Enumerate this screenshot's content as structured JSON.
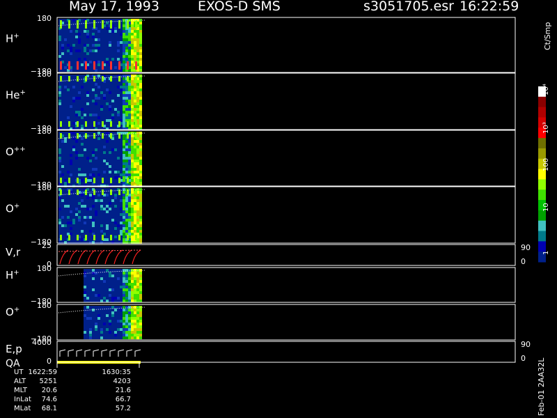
{
  "header": {
    "date": "May 17, 1993",
    "instrument": "EXOS-D SMS",
    "file": "s3051705.esr",
    "time": "16:22:59"
  },
  "panels": [
    {
      "label_base": "H",
      "label_sup": "+",
      "ytop": "180",
      "ybot": "−180"
    },
    {
      "label_base": "He",
      "label_sup": "+",
      "ytop": "180",
      "ybot": "−180"
    },
    {
      "label_base": "O",
      "label_sup": "++",
      "ytop": "180",
      "ybot": "−180"
    },
    {
      "label_base": "O",
      "label_sup": "+",
      "ytop": "180",
      "ybot": "−180"
    },
    {
      "label_base": "V,r",
      "label_sup": "",
      "ytop": "25",
      "ybot": "0",
      "rtop": "90",
      "rbot": "0"
    },
    {
      "label_base": "H",
      "label_sup": "+",
      "ytop": "180",
      "ybot": "−180"
    },
    {
      "label_base": "O",
      "label_sup": "+",
      "ytop": "180",
      "ybot": "−180"
    },
    {
      "label_base": "E,p",
      "label_sup": "",
      "label2": "QA",
      "ytop": "4000",
      "ybot": "0",
      "rtop": "90",
      "rbot": "0"
    }
  ],
  "colorbar": {
    "label": "Ct/Smp",
    "ticks": [
      "10⁴",
      "10³",
      "100",
      "10",
      "1"
    ],
    "colors": [
      "#ffffff",
      "#8b0000",
      "#b00000",
      "#d40000",
      "#ff0000",
      "#707000",
      "#9a9a00",
      "#c8c800",
      "#ffff00",
      "#90ff00",
      "#40e000",
      "#00c000",
      "#00a000",
      "#40c0c0",
      "#007a8a",
      "#0000b0",
      "#00208a"
    ]
  },
  "time_table": {
    "rows": [
      {
        "label": "UT",
        "v1": "1622:59",
        "v2": "1630:35"
      },
      {
        "label": "ALT",
        "v1": "5251",
        "v2": "4203"
      },
      {
        "label": "MLT",
        "v1": "20.6",
        "v2": "21.6"
      },
      {
        "label": "InLat",
        "v1": "74.6",
        "v2": "66.7"
      },
      {
        "label": "MLat",
        "v1": "68.1",
        "v2": "57.2"
      }
    ]
  },
  "footer_id": "Feb-01 2AA32L",
  "chart_data": {
    "type": "heatmap",
    "title": "May 17, 1993   EXOS-D SMS",
    "xlabel": "UT",
    "x_ticks": [
      "1622:59",
      "1630:35"
    ],
    "ylim_angle": [
      -180,
      180
    ],
    "colorscale_label": "Ct/Smp",
    "colorscale_log": true,
    "colorscale_range": [
      1,
      10000
    ]
  }
}
